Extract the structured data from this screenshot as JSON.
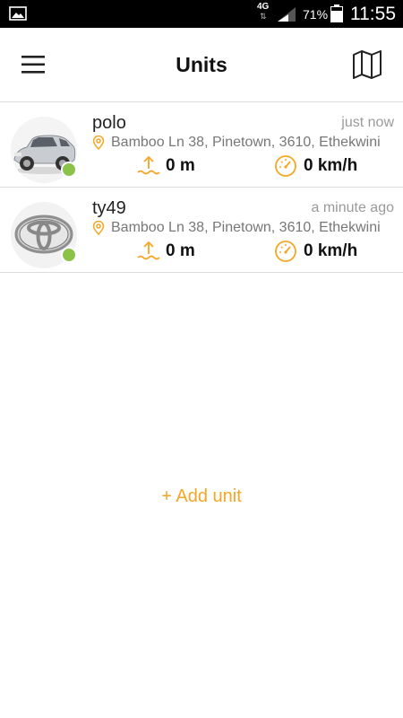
{
  "status_bar": {
    "network": "4G",
    "battery": "71%",
    "time": "11:55",
    "icons": [
      "image-icon",
      "data-arrows-icon",
      "signal-icon",
      "battery-icon"
    ]
  },
  "header": {
    "title": "Units",
    "menu_icon": "hamburger-menu-icon",
    "map_icon": "map-icon"
  },
  "units": [
    {
      "name": "polo",
      "last_seen": "just now",
      "address": "Bamboo Ln 38, Pinetown, 3610, Ethekwini",
      "altitude": "0 m",
      "speed": "0 km/h",
      "status": "online",
      "avatar": "car-photo-icon"
    },
    {
      "name": "ty49",
      "last_seen": "a minute ago",
      "address": "Bamboo Ln 38, Pinetown, 3610, Ethekwini",
      "altitude": "0 m",
      "speed": "0 km/h",
      "status": "online",
      "avatar": "toyota-logo-icon"
    }
  ],
  "add_unit_label": "+ Add unit",
  "colors": {
    "accent": "#f5a623",
    "online": "#8bc34a",
    "status_bar": "#000000",
    "secondary_text": "#9a9a9a"
  }
}
